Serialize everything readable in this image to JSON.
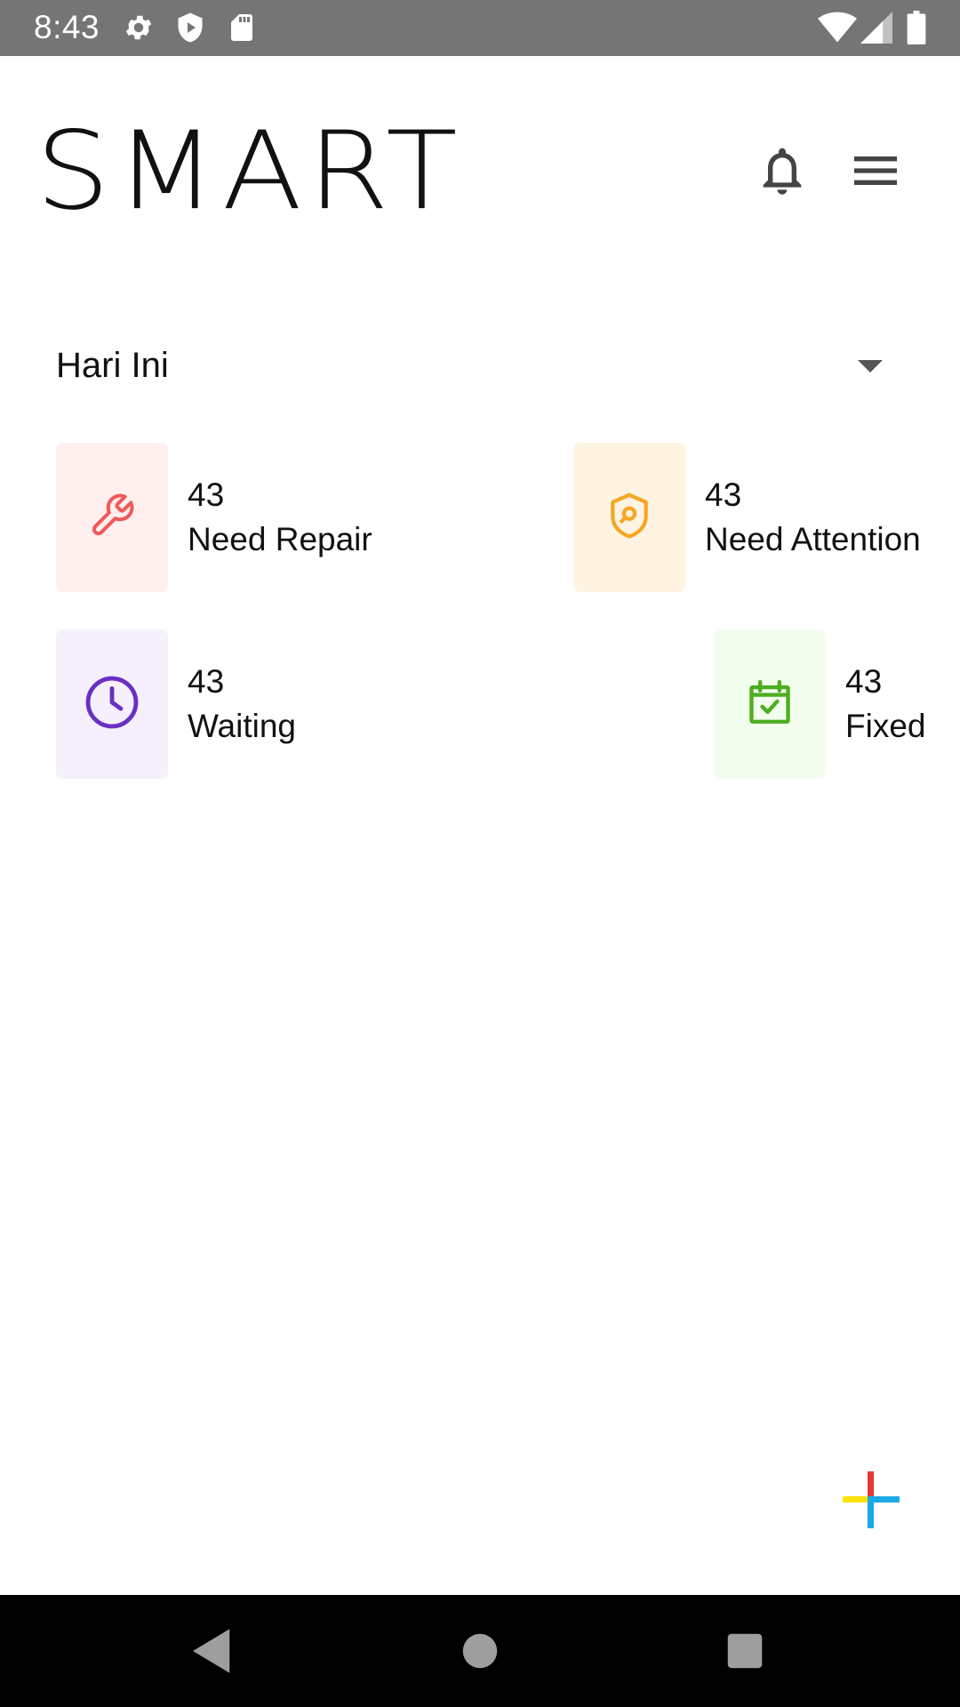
{
  "status_bar": {
    "time": "8:43",
    "left_icons": [
      "gear-icon",
      "shield-icon",
      "sd-card-icon"
    ],
    "right_icons": [
      "wifi-icon",
      "cell-signal-icon",
      "battery-icon"
    ]
  },
  "header": {
    "logo_text": "SMART",
    "actions": [
      "bell-icon",
      "menu-icon"
    ]
  },
  "period_selector": {
    "selected": "Hari Ini"
  },
  "stats": [
    {
      "count": "43",
      "label": "Need Repair",
      "icon": "wrench-icon",
      "color": "#f05a5a",
      "bg": "#fff0ef"
    },
    {
      "count": "43",
      "label": "Need Attention",
      "icon": "shield-search-icon",
      "color": "#f5a623",
      "bg": "#fff4e2"
    },
    {
      "count": "43",
      "label": "Waiting",
      "icon": "clock-icon",
      "color": "#6a2fc4",
      "bg": "#f6effc"
    },
    {
      "count": "43",
      "label": "Fixed",
      "icon": "calendar-check-icon",
      "color": "#4cae1f",
      "bg": "#f3fdee"
    }
  ],
  "fab": {
    "icon": "plus-icon",
    "colors": [
      "#e53935",
      "#fbe10a",
      "#1ea9e6"
    ]
  },
  "nav_bar": {
    "buttons": [
      "back-icon",
      "home-icon",
      "recents-icon"
    ]
  }
}
